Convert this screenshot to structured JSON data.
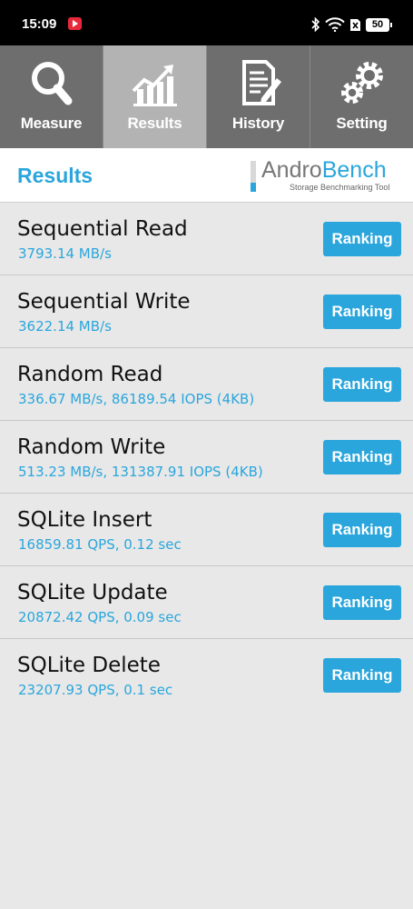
{
  "status_bar": {
    "time": "15:09",
    "battery": "50",
    "icons": [
      "youtube-notification-icon",
      "bluetooth-icon",
      "wifi-icon",
      "no-sim-icon",
      "battery-icon"
    ]
  },
  "tabs": [
    {
      "label": "Measure",
      "icon": "magnifier-icon",
      "active": false
    },
    {
      "label": "Results",
      "icon": "bar-chart-icon",
      "active": true
    },
    {
      "label": "History",
      "icon": "document-pencil-icon",
      "active": false
    },
    {
      "label": "Setting",
      "icon": "gears-icon",
      "active": false
    }
  ],
  "header": {
    "title": "Results",
    "logo_name_part1": "Andro",
    "logo_name_part2": "Bench",
    "logo_tagline": "Storage Benchmarking Tool"
  },
  "results": [
    {
      "name": "Sequential Read",
      "value": "3793.14 MB/s",
      "button": "Ranking"
    },
    {
      "name": "Sequential Write",
      "value": "3622.14 MB/s",
      "button": "Ranking"
    },
    {
      "name": "Random Read",
      "value": "336.67 MB/s, 86189.54 IOPS (4KB)",
      "button": "Ranking"
    },
    {
      "name": "Random Write",
      "value": "513.23 MB/s, 131387.91 IOPS (4KB)",
      "button": "Ranking"
    },
    {
      "name": "SQLite Insert",
      "value": "16859.81 QPS, 0.12 sec",
      "button": "Ranking"
    },
    {
      "name": "SQLite Update",
      "value": "20872.42 QPS, 0.09 sec",
      "button": "Ranking"
    },
    {
      "name": "SQLite Delete",
      "value": "23207.93 QPS, 0.1 sec",
      "button": "Ranking"
    }
  ],
  "colors": {
    "accent": "#2aa6dc",
    "tab_bg": "#6e6e6e",
    "tab_active_bg": "#b3b3b3",
    "list_bg": "#e8e8e8"
  }
}
